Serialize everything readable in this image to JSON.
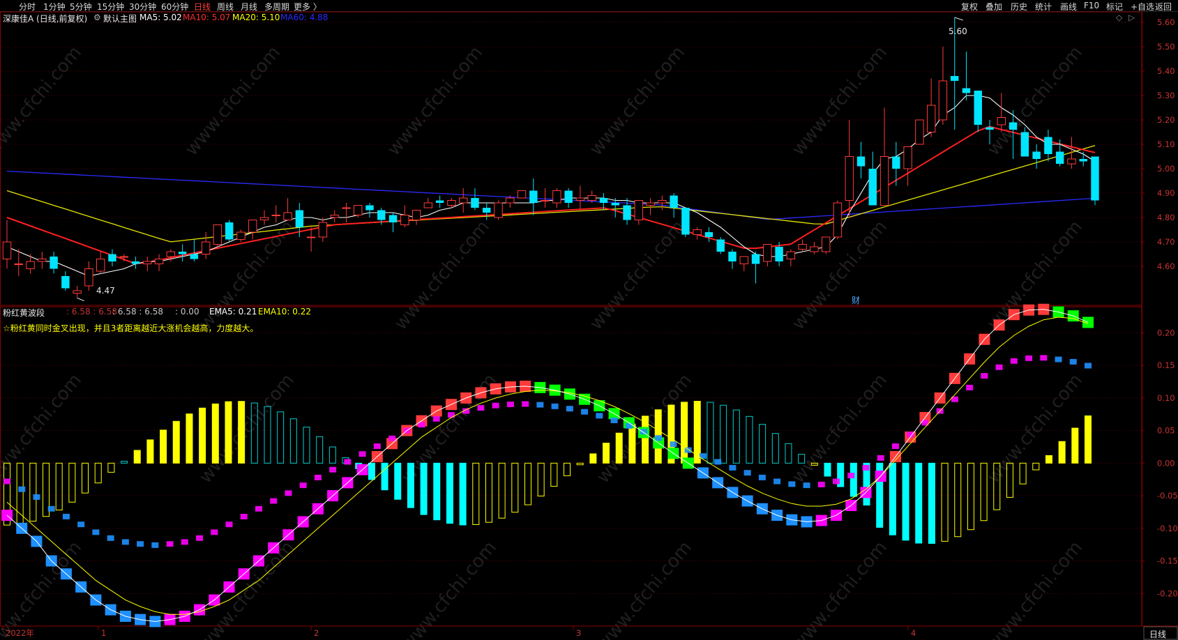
{
  "toolbar": {
    "periods": [
      "分时",
      "1分钟",
      "5分钟",
      "15分钟",
      "30分钟",
      "60分钟",
      "日线",
      "周线",
      "月线",
      "多周期",
      "更多 〉"
    ],
    "active_period": "日线",
    "right_buttons": [
      "复权",
      "叠加",
      "历史",
      "统计",
      "画线",
      "F10",
      "标记",
      "+自选",
      "返回"
    ]
  },
  "main_panel": {
    "stock": "深康佳A (日线,前复权)",
    "indicator_name": "默认主图",
    "ma": [
      {
        "label": "MA5: 5.02",
        "color": "#ffffff"
      },
      {
        "label": "MA10: 5.07",
        "color": "#ff2a2a"
      },
      {
        "label": "MA20: 5.10",
        "color": "#ffff00"
      },
      {
        "label": "MA60: 4.88",
        "color": "#2a2aff"
      }
    ],
    "high_label": "5.60",
    "low_label": "4.47",
    "event_marker": "财",
    "y_ticks": [
      "5.60",
      "5.50",
      "5.40",
      "5.30",
      "5.20",
      "5.10",
      "5.00",
      "4.90",
      "4.80",
      "4.70",
      "4.60"
    ]
  },
  "sub_panel": {
    "name": "粉红黄波段",
    "values_a": ": 6.58 : 6.58",
    "values_b": ": 6.58 : 6.58",
    "value_c": ": 0.00",
    "ema5": "EMA5: 0.21",
    "ema10": "EMA10: 0.22",
    "note": "☆粉红黄同时金叉出现，并且3者距离越近大涨机会越高，力度越大。",
    "y_ticks": [
      "0.20",
      "0.15",
      "0.10",
      "0.05",
      "0.00",
      "-0.05",
      "-0.10",
      "-0.15",
      "-0.20"
    ]
  },
  "x_axis": {
    "labels": [
      "2022年",
      "1",
      "2",
      "3",
      "4"
    ],
    "period_box": "日线"
  },
  "watermark": "www.cfchi.com",
  "colors": {
    "up": "#ff3b3b",
    "down": "#00e5ff",
    "ma5": "#ffffff",
    "ma10": "#ff2020",
    "ma20": "#e6e600",
    "ma60": "#2b2bff",
    "grid": "#5a0000",
    "frame": "#8b0000",
    "pink": "#ff00ff",
    "yellow": "#ffff00",
    "green": "#00ff00",
    "blue": "#1e90ff"
  },
  "chart_data": [
    {
      "type": "candlestick",
      "title": "深康佳A (日线,前复权)",
      "ylim": [
        4.44,
        5.64
      ],
      "candles": [
        [
          4.63,
          4.79,
          4.7,
          4.59
        ],
        [
          4.61,
          4.67,
          4.61,
          4.56
        ],
        [
          4.59,
          4.65,
          4.62,
          4.57
        ],
        [
          4.62,
          4.66,
          4.63,
          4.59
        ],
        [
          4.64,
          4.66,
          4.59,
          4.57
        ],
        [
          4.56,
          4.58,
          4.51,
          4.5
        ],
        [
          4.49,
          4.52,
          4.5,
          4.47
        ],
        [
          4.52,
          4.62,
          4.59,
          4.5
        ],
        [
          4.58,
          4.66,
          4.63,
          4.57
        ],
        [
          4.65,
          4.67,
          4.62,
          4.6
        ],
        [
          4.64,
          4.65,
          4.64,
          4.62
        ],
        [
          4.62,
          4.64,
          4.61,
          4.59
        ],
        [
          4.61,
          4.64,
          4.62,
          4.58
        ],
        [
          4.61,
          4.65,
          4.63,
          4.58
        ],
        [
          4.64,
          4.67,
          4.66,
          4.62
        ],
        [
          4.66,
          4.69,
          4.65,
          4.62
        ],
        [
          4.65,
          4.71,
          4.63,
          4.62
        ],
        [
          4.65,
          4.74,
          4.7,
          4.63
        ],
        [
          4.69,
          4.77,
          4.77,
          4.67
        ],
        [
          4.78,
          4.79,
          4.71,
          4.7
        ],
        [
          4.71,
          4.75,
          4.74,
          4.7
        ],
        [
          4.74,
          4.79,
          4.79,
          4.71
        ],
        [
          4.79,
          4.83,
          4.8,
          4.77
        ],
        [
          4.81,
          4.85,
          4.81,
          4.78
        ],
        [
          4.79,
          4.88,
          4.82,
          4.79
        ],
        [
          4.83,
          4.86,
          4.76,
          4.72
        ],
        [
          4.72,
          4.76,
          4.72,
          4.66
        ],
        [
          4.72,
          4.8,
          4.78,
          4.7
        ],
        [
          4.8,
          4.83,
          4.81,
          4.78
        ],
        [
          4.84,
          4.86,
          4.84,
          4.78
        ],
        [
          4.81,
          4.84,
          4.85,
          4.8
        ],
        [
          4.85,
          4.86,
          4.83,
          4.8
        ],
        [
          4.83,
          4.84,
          4.79,
          4.77
        ],
        [
          4.81,
          4.82,
          4.78,
          4.74
        ],
        [
          4.77,
          4.85,
          4.81,
          4.76
        ],
        [
          4.79,
          4.83,
          4.83,
          4.77
        ],
        [
          4.84,
          4.88,
          4.86,
          4.84
        ],
        [
          4.87,
          4.89,
          4.86,
          4.84
        ],
        [
          4.85,
          4.88,
          4.87,
          4.84
        ],
        [
          4.86,
          4.92,
          4.88,
          4.82
        ],
        [
          4.88,
          4.92,
          4.84,
          4.83
        ],
        [
          4.84,
          4.86,
          4.82,
          4.79
        ],
        [
          4.8,
          4.87,
          4.86,
          4.79
        ],
        [
          4.86,
          4.89,
          4.88,
          4.84
        ],
        [
          4.88,
          4.91,
          4.91,
          4.88
        ],
        [
          4.91,
          4.96,
          4.86,
          4.81
        ],
        [
          4.87,
          4.92,
          4.87,
          4.84
        ],
        [
          4.86,
          4.92,
          4.91,
          4.84
        ],
        [
          4.91,
          4.92,
          4.86,
          4.84
        ],
        [
          4.87,
          4.93,
          4.88,
          4.83
        ],
        [
          4.87,
          4.91,
          4.89,
          4.86
        ],
        [
          4.88,
          4.9,
          4.86,
          4.83
        ],
        [
          4.86,
          4.88,
          4.85,
          4.8
        ],
        [
          4.85,
          4.88,
          4.79,
          4.77
        ],
        [
          4.79,
          4.87,
          4.87,
          4.77
        ],
        [
          4.85,
          4.88,
          4.86,
          4.81
        ],
        [
          4.86,
          4.89,
          4.87,
          4.83
        ],
        [
          4.89,
          4.9,
          4.84,
          4.8
        ],
        [
          4.84,
          4.82,
          4.73,
          4.72
        ],
        [
          4.73,
          4.76,
          4.75,
          4.71
        ],
        [
          4.74,
          4.76,
          4.72,
          4.7
        ],
        [
          4.71,
          4.72,
          4.66,
          4.65
        ],
        [
          4.66,
          4.67,
          4.62,
          4.59
        ],
        [
          4.61,
          4.64,
          4.64,
          4.58
        ],
        [
          4.65,
          4.66,
          4.61,
          4.53
        ],
        [
          4.62,
          4.69,
          4.69,
          4.6
        ],
        [
          4.68,
          4.7,
          4.62,
          4.6
        ],
        [
          4.63,
          4.67,
          4.66,
          4.6
        ],
        [
          4.67,
          4.71,
          4.69,
          4.66
        ],
        [
          4.66,
          4.7,
          4.68,
          4.65
        ],
        [
          4.66,
          4.72,
          4.72,
          4.65
        ],
        [
          4.72,
          4.87,
          4.86,
          4.71
        ],
        [
          4.87,
          5.2,
          5.05,
          4.8
        ],
        [
          5.05,
          5.11,
          5.01,
          4.96
        ],
        [
          5.0,
          5.07,
          4.85,
          4.85
        ],
        [
          4.85,
          5.25,
          5.05,
          4.85
        ],
        [
          5.05,
          5.11,
          5.0,
          4.93
        ],
        [
          5.0,
          5.09,
          5.09,
          4.93
        ],
        [
          5.1,
          5.19,
          5.2,
          5.17
        ],
        [
          5.15,
          5.37,
          5.26,
          5.13
        ],
        [
          5.2,
          5.5,
          5.36,
          5.18
        ],
        [
          5.38,
          5.62,
          5.36,
          5.16
        ],
        [
          5.33,
          5.48,
          5.31,
          5.28
        ],
        [
          5.32,
          5.29,
          5.18,
          5.15
        ],
        [
          5.17,
          5.2,
          5.16,
          5.1
        ],
        [
          5.18,
          5.31,
          5.21,
          5.15
        ],
        [
          5.19,
          5.24,
          5.16,
          5.04
        ],
        [
          5.15,
          5.17,
          5.05,
          5.05
        ],
        [
          5.07,
          5.1,
          5.04,
          5.0
        ],
        [
          5.13,
          5.16,
          5.06,
          5.03
        ],
        [
          5.07,
          5.12,
          5.02,
          5.01
        ],
        [
          5.02,
          5.13,
          5.04,
          5.0
        ],
        [
          5.04,
          5.07,
          5.03,
          5.01
        ],
        [
          5.05,
          5.05,
          4.87,
          4.85
        ]
      ],
      "ma5": [
        4.68,
        4.66,
        4.64,
        4.62,
        4.62,
        4.6,
        4.58,
        4.56,
        4.57,
        4.58,
        4.59,
        4.61,
        4.62,
        4.62,
        4.63,
        4.64,
        4.65,
        4.66,
        4.68,
        4.7,
        4.72,
        4.74,
        4.76,
        4.77,
        4.79,
        4.8,
        4.8,
        4.79,
        4.8,
        4.8,
        4.81,
        4.82,
        4.82,
        4.82,
        4.81,
        4.8,
        4.81,
        4.83,
        4.84,
        4.86,
        4.86,
        4.86,
        4.86,
        4.86,
        4.86,
        4.86,
        4.87,
        4.87,
        4.88,
        4.88,
        4.88,
        4.88,
        4.87,
        4.87,
        4.86,
        4.86,
        4.86,
        4.86,
        4.84,
        4.82,
        4.79,
        4.76,
        4.72,
        4.68,
        4.65,
        4.64,
        4.64,
        4.65,
        4.66,
        4.67,
        4.68,
        4.73,
        4.82,
        4.9,
        4.98,
        5.04,
        5.05,
        5.08,
        5.12,
        5.15,
        5.22,
        5.25,
        5.3,
        5.3,
        5.29,
        5.25,
        5.22,
        5.18,
        5.13,
        5.1,
        5.1,
        5.08,
        5.06,
        5.03
      ]
    },
    {
      "type": "bar",
      "title": "粉红黄波段",
      "ylim": [
        -0.25,
        0.24
      ],
      "ema5": [
        -0.08,
        -0.1,
        -0.12,
        -0.15,
        -0.17,
        -0.19,
        -0.21,
        -0.225,
        -0.235,
        -0.24,
        -0.243,
        -0.24,
        -0.235,
        -0.225,
        -0.21,
        -0.19,
        -0.17,
        -0.15,
        -0.13,
        -0.11,
        -0.09,
        -0.07,
        -0.05,
        -0.03,
        -0.01,
        0.01,
        0.03,
        0.05,
        0.065,
        0.08,
        0.09,
        0.1,
        0.108,
        0.114,
        0.117,
        0.118,
        0.116,
        0.112,
        0.106,
        0.098,
        0.088,
        0.076,
        0.062,
        0.047,
        0.031,
        0.015,
        0.0,
        -0.015,
        -0.03,
        -0.045,
        -0.058,
        -0.07,
        -0.08,
        -0.087,
        -0.09,
        -0.088,
        -0.08,
        -0.065,
        -0.045,
        -0.02,
        0.01,
        0.04,
        0.07,
        0.1,
        0.13,
        0.16,
        0.19,
        0.212,
        0.228,
        0.235,
        0.236,
        0.232,
        0.226,
        0.216
      ],
      "ema10": [
        -0.06,
        -0.08,
        -0.1,
        -0.12,
        -0.14,
        -0.16,
        -0.18,
        -0.195,
        -0.21,
        -0.22,
        -0.228,
        -0.232,
        -0.232,
        -0.228,
        -0.22,
        -0.21,
        -0.195,
        -0.18,
        -0.16,
        -0.14,
        -0.12,
        -0.1,
        -0.08,
        -0.06,
        -0.04,
        -0.02,
        0.0,
        0.02,
        0.04,
        0.055,
        0.07,
        0.082,
        0.092,
        0.1,
        0.106,
        0.11,
        0.112,
        0.111,
        0.108,
        0.103,
        0.096,
        0.087,
        0.076,
        0.064,
        0.05,
        0.036,
        0.021,
        0.006,
        -0.008,
        -0.022,
        -0.035,
        -0.046,
        -0.055,
        -0.062,
        -0.066,
        -0.066,
        -0.063,
        -0.055,
        -0.04,
        -0.02,
        0.005,
        0.03,
        0.055,
        0.08,
        0.105,
        0.13,
        0.155,
        0.178,
        0.196,
        0.21,
        0.22,
        0.224,
        0.222,
        0.214
      ]
    }
  ]
}
